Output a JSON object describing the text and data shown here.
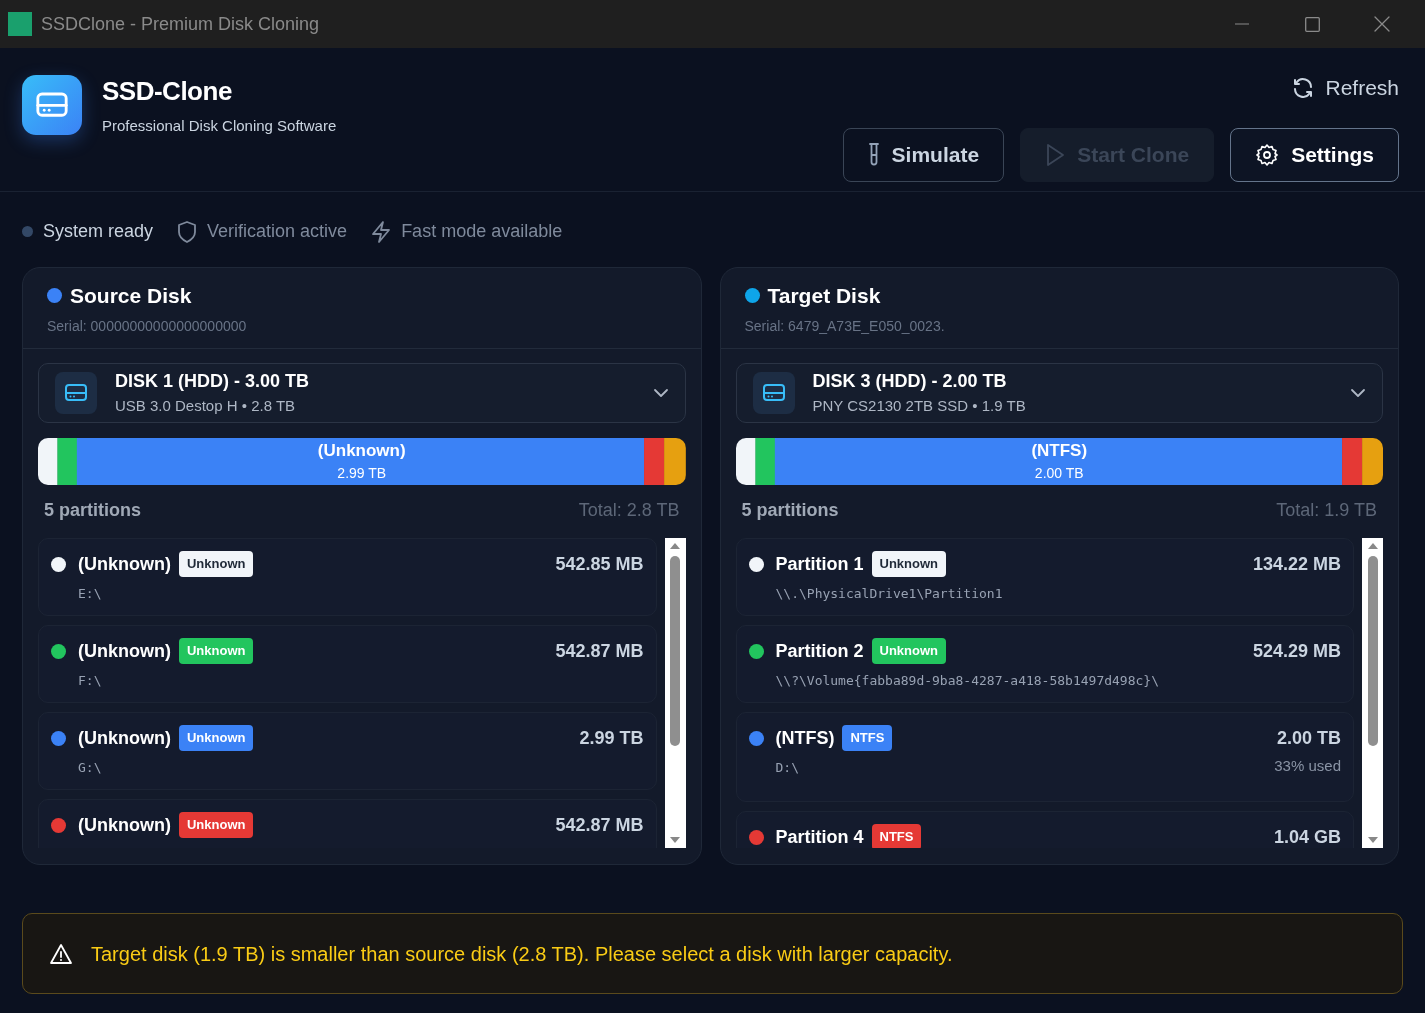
{
  "window": {
    "title": "SSDClone - Premium Disk Cloning"
  },
  "header": {
    "app_name": "SSD-Clone",
    "subtitle": "Professional Disk Cloning Software"
  },
  "refresh": {
    "label": "Refresh"
  },
  "buttons": [
    {
      "kind": "simulate",
      "label": "Simulate",
      "disabled": false
    },
    {
      "kind": "start",
      "label": "Start Clone",
      "disabled": true
    },
    {
      "kind": "settings",
      "label": "Settings",
      "disabled": false
    }
  ],
  "status": [
    {
      "kind": "dot",
      "label": "System ready"
    },
    {
      "kind": "shield",
      "label": "Verification active"
    },
    {
      "kind": "bolt",
      "label": "Fast mode available"
    }
  ],
  "disks": [
    {
      "title": "Source Disk",
      "color": "#3b82f6",
      "serial": "Serial: 00000000000000000000",
      "selector": {
        "name": "DISK 1 (HDD) - 3.00 TB",
        "detail": "USB 3.0 Destop H • 2.8 TB"
      },
      "layout": {
        "label": "(Unknown)",
        "size": "2.99 TB"
      },
      "partition_count": "5 partitions",
      "total": "Total: 2.8 TB",
      "partitions": [
        {
          "name": "(Unknown)",
          "badge": "Unknown",
          "color": "#f1f5f9",
          "path": "E:\\",
          "size": "542.85 MB"
        },
        {
          "name": "(Unknown)",
          "badge": "Unknown",
          "color": "#22c55e",
          "path": "F:\\",
          "size": "542.87 MB"
        },
        {
          "name": "(Unknown)",
          "badge": "Unknown",
          "color": "#3b82f6",
          "path": "G:\\",
          "size": "2.99 TB"
        },
        {
          "name": "(Unknown)",
          "badge": "Unknown",
          "color": "#e53935",
          "size": "542.87 MB"
        }
      ]
    },
    {
      "title": "Target Disk",
      "color": "#0ea5e9",
      "serial": "Serial: 6479_A73E_E050_0023.",
      "selector": {
        "name": "DISK 3 (HDD) - 2.00 TB",
        "detail": "PNY CS2130 2TB SSD • 1.9 TB"
      },
      "layout": {
        "label": "(NTFS)",
        "size": "2.00 TB"
      },
      "partition_count": "5 partitions",
      "total": "Total: 1.9 TB",
      "partitions": [
        {
          "name": "Partition 1",
          "badge": "Unknown",
          "color": "#f1f5f9",
          "path": "\\\\.\\PhysicalDrive1\\Partition1",
          "size": "134.22 MB"
        },
        {
          "name": "Partition 2",
          "badge": "Unknown",
          "color": "#22c55e",
          "path": "\\\\?\\Volume{fabba89d-9ba8-4287-a418-58b1497d498c}\\",
          "size": "524.29 MB"
        },
        {
          "name": "(NTFS)",
          "badge": "NTFS",
          "color": "#3b82f6",
          "path": "D:\\",
          "size": "2.00 TB",
          "usage": "33% used"
        },
        {
          "name": "Partition 4",
          "badge": "NTFS",
          "color": "#e53935",
          "size": "1.04 GB"
        }
      ]
    }
  ],
  "warning": "Target disk (1.9 TB) is smaller than source disk (2.8 TB). Please select a disk with larger capacity."
}
